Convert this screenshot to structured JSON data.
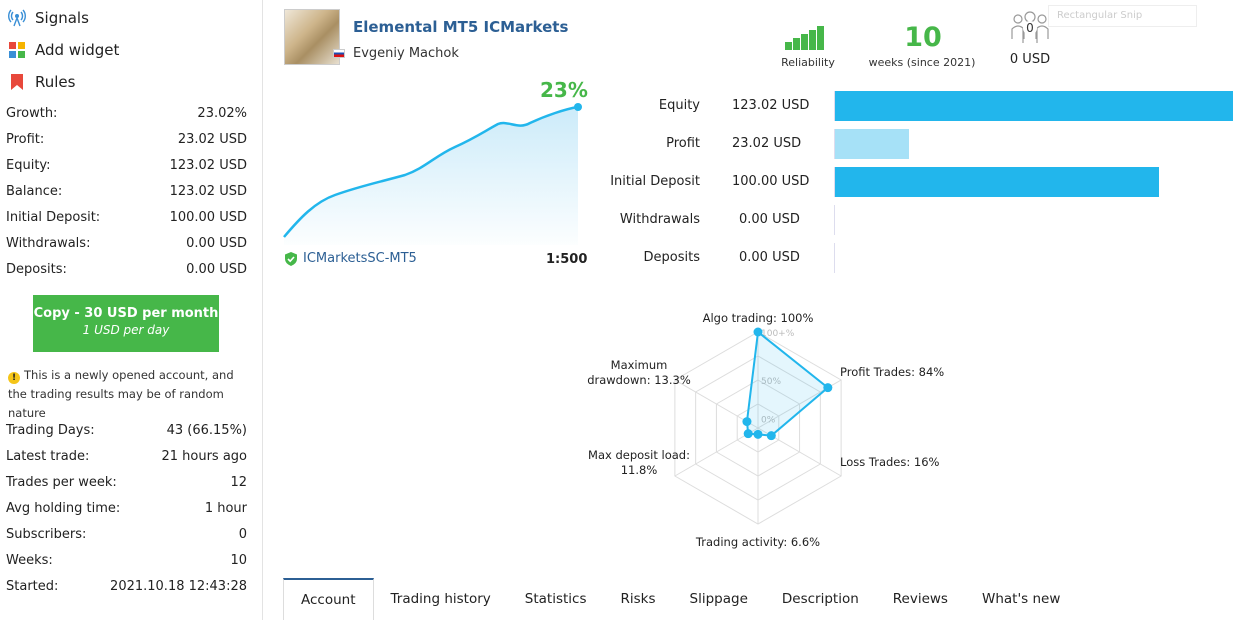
{
  "sidebar": {
    "nav": [
      {
        "label": "Signals",
        "icon": "signal-antenna-icon"
      },
      {
        "label": "Add widget",
        "icon": "widget-grid-icon"
      },
      {
        "label": "Rules",
        "icon": "bookmark-icon"
      }
    ],
    "stats": [
      {
        "label": "Growth:",
        "value": "23.02%"
      },
      {
        "label": "Profit:",
        "value": "23.02 USD"
      },
      {
        "label": "Equity:",
        "value": "123.02 USD"
      },
      {
        "label": "Balance:",
        "value": "123.02 USD"
      },
      {
        "label": "Initial Deposit:",
        "value": "100.00 USD"
      },
      {
        "label": "Withdrawals:",
        "value": "0.00 USD"
      },
      {
        "label": "Deposits:",
        "value": "0.00 USD"
      }
    ],
    "copy_button": {
      "line1": "Copy - 30 USD per month",
      "line2": "1 USD per day"
    },
    "warning": "This is a newly opened account, and the trading results may be of random nature",
    "details": [
      {
        "label": "Trading Days:",
        "value": "43 (66.15%)"
      },
      {
        "label": "Latest trade:",
        "value": "21 hours ago"
      },
      {
        "label": "Trades per week:",
        "value": "12"
      },
      {
        "label": "Avg holding time:",
        "value": "1 hour"
      },
      {
        "label": "Subscribers:",
        "value": "0"
      },
      {
        "label": "Weeks:",
        "value": "10"
      },
      {
        "label": "Started:",
        "value": "2021.10.18 12:43:28"
      }
    ]
  },
  "header": {
    "title": "Elemental MT5 ICMarkets",
    "author": "Evgeniy Machok",
    "reliability_label": "Reliability",
    "weeks_value": "10",
    "weeks_label": "weeks (since 2021)",
    "subscribers_count": "0",
    "subscribers_funds": "0 USD",
    "snip_label": "Rectangular Snip"
  },
  "growth": {
    "percent": "23%",
    "broker": "ICMarketsSC-MT5",
    "leverage": "1:500"
  },
  "balance_bars": [
    {
      "label": "Equity",
      "value": "123.02 USD",
      "amount": 123.02,
      "color": "#22b6ec"
    },
    {
      "label": "Profit",
      "value": "23.02 USD",
      "amount": 23.02,
      "color": "#a6e1f7"
    },
    {
      "label": "Initial Deposit",
      "value": "100.00 USD",
      "amount": 100.0,
      "color": "#22b6ec"
    },
    {
      "label": "Withdrawals",
      "value": "0.00 USD",
      "amount": 0,
      "color": "#22b6ec"
    },
    {
      "label": "Deposits",
      "value": "0.00 USD",
      "amount": 0,
      "color": "#22b6ec"
    }
  ],
  "radar": {
    "scale_labels": [
      "100+%",
      "50%",
      "0%"
    ],
    "axes": [
      {
        "label": "Algo trading: 100%",
        "value": 100
      },
      {
        "label": "Profit Trades: 84%",
        "value": 84
      },
      {
        "label": "Loss Trades: 16%",
        "value": 16
      },
      {
        "label": "Trading activity: 6.6%",
        "value": 6.6
      },
      {
        "label": "Max deposit load:\n11.8%",
        "value": 11.8
      },
      {
        "label": "Maximum\ndrawdown: 13.3%",
        "value": 13.3
      }
    ]
  },
  "tabs": [
    "Account",
    "Trading history",
    "Statistics",
    "Risks",
    "Slippage",
    "Description",
    "Reviews",
    "What's new"
  ],
  "colors": {
    "accent_green": "#46b749",
    "link_blue": "#2c5f94",
    "bar_blue": "#22b6ec"
  }
}
